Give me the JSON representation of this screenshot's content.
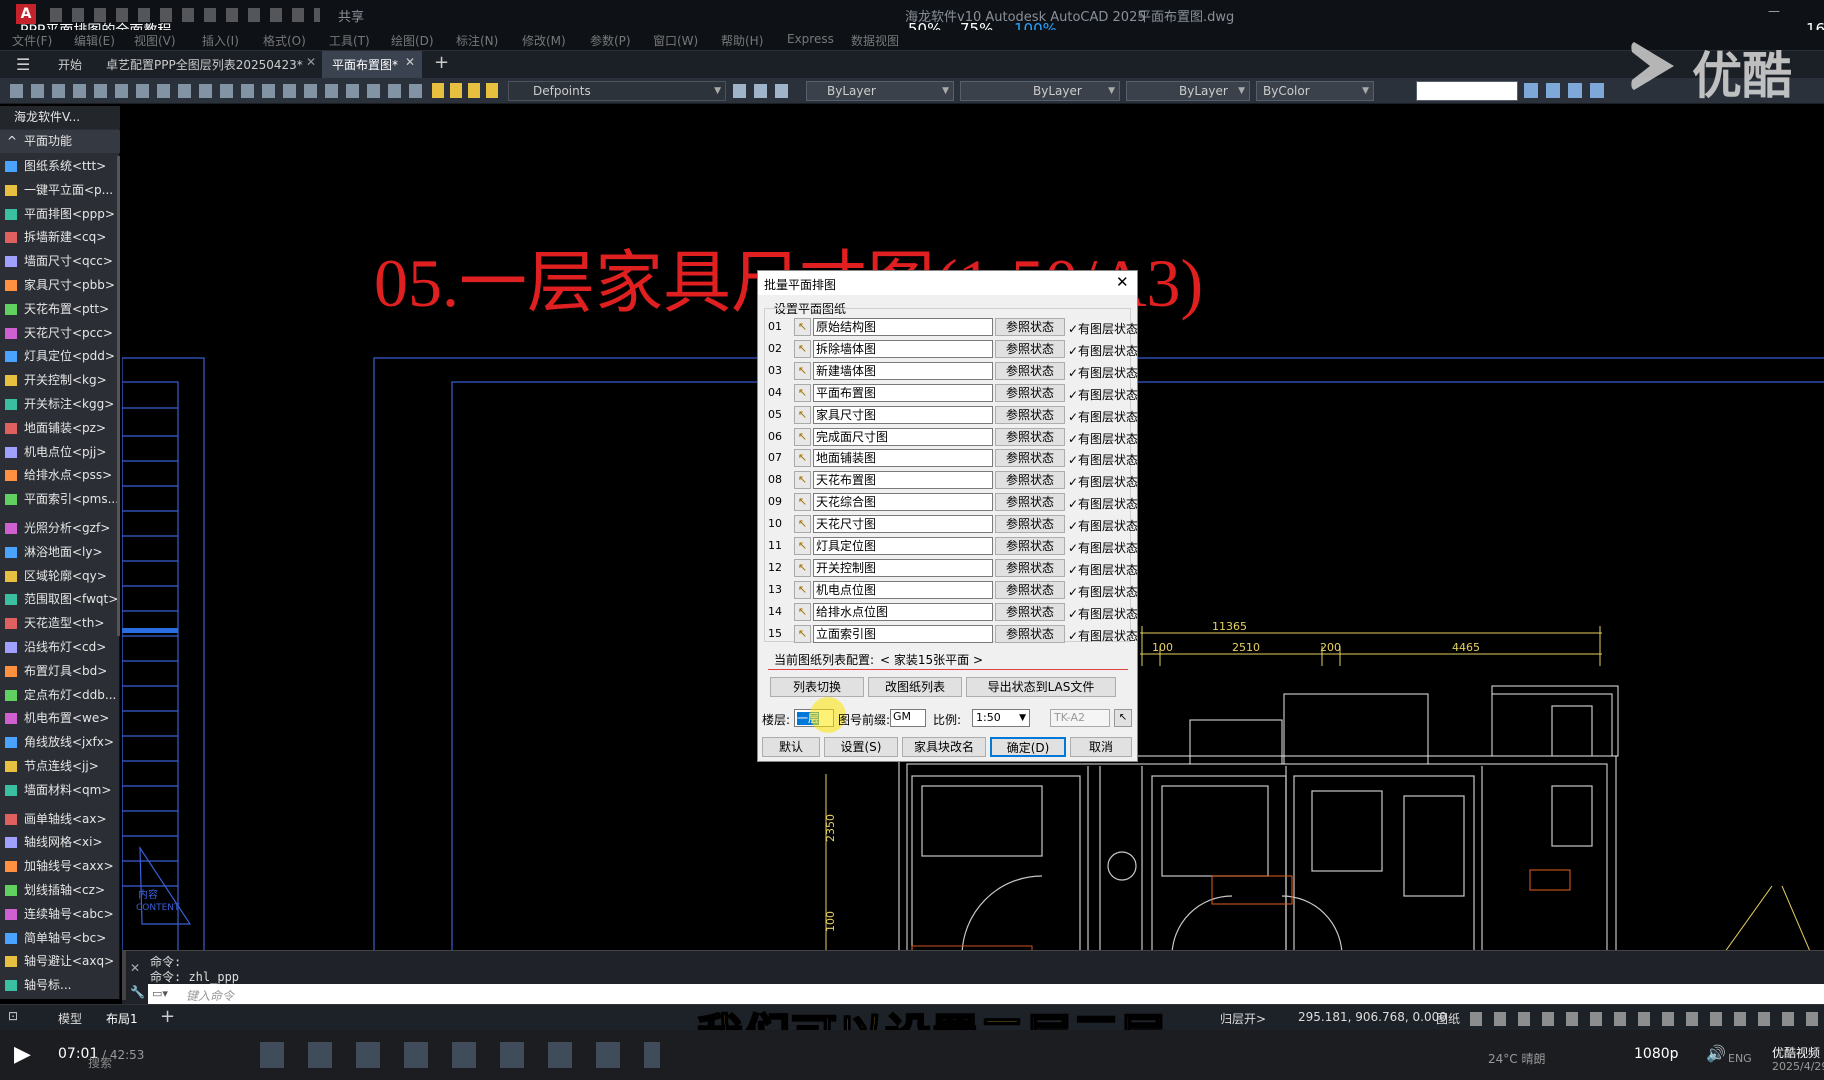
{
  "titlebar": {
    "video_title": "PPP平面排图的全面教程",
    "app_title": "海龙软件v10 Autodesk AutoCAD 2025",
    "file_name": "平面布置图.dwg",
    "share": "共享",
    "speed": [
      "50%",
      "75%",
      "100%"
    ],
    "clock_tail": "16"
  },
  "menu": [
    "文件(F)",
    "编辑(E)",
    "视图(V)",
    "插入(I)",
    "格式(O)",
    "工具(T)",
    "绘图(D)",
    "标注(N)",
    "修改(M)",
    "参数(P)",
    "窗口(W)",
    "帮助(H)",
    "Express",
    "数据视图"
  ],
  "tabs": {
    "start": "开始",
    "tab1": "卓艺配置PPP全图层列表20250423*",
    "tab2": "平面布置图*"
  },
  "toolbar": {
    "layer": "Defpoints",
    "color": "ByLayer",
    "linetype": "ByLayer",
    "lineweight": "ByLayer",
    "plotstyle": "ByColor"
  },
  "watermark": "优酷",
  "palette": {
    "header": "海龙软件V...",
    "section": "平面功能",
    "items": [
      "图纸系统<ttt>",
      "一键平立面<p...",
      "平面排图<ppp>",
      "拆墙新建<cq>",
      "墙面尺寸<qcc>",
      "家具尺寸<pbb>",
      "天花布置<ptt>",
      "天花尺寸<pcc>",
      "灯具定位<pdd>",
      "开关控制<kg>",
      "开关标注<kgg>",
      "地面铺装<pz>",
      "机电点位<pjj>",
      "给排水点<pss>",
      "平面索引<pms...",
      "光照分析<gzf>",
      "淋浴地面<ly>",
      "区域轮廓<qy>",
      "范围取图<fwqt>",
      "天花造型<th>",
      "沿线布灯<cd>",
      "布置灯具<bd>",
      "定点布灯<ddb...",
      "机电布置<we>",
      "角线放线<jxfx>",
      "节点连线<jj>",
      "墙面材料<qm>",
      "画单轴线<ax>",
      "轴线网格<xi>",
      "加轴线号<axx>",
      "划线插轴<cz>",
      "连续轴号<abc>",
      "简单轴号<bc>",
      "轴号避让<axq>",
      "轴号标..."
    ]
  },
  "drawing": {
    "title": "05.一层家具尺寸图(1:50/A3)",
    "dims": {
      "total": "11365",
      "d1": "100",
      "d2": "2510",
      "d3": "200",
      "d4": "4465",
      "v1": "2350",
      "v2": "100"
    },
    "small_text": "内容\nCONTENT"
  },
  "dialog": {
    "title": "批量平面排图",
    "group": "设置平面图纸",
    "ref_label": "参照状态",
    "state_label": "✓有图层状态",
    "rows": [
      {
        "n": "01",
        "name": "原始结构图"
      },
      {
        "n": "02",
        "name": "拆除墙体图"
      },
      {
        "n": "03",
        "name": "新建墙体图"
      },
      {
        "n": "04",
        "name": "平面布置图"
      },
      {
        "n": "05",
        "name": "家具尺寸图"
      },
      {
        "n": "06",
        "name": "完成面尺寸图"
      },
      {
        "n": "07",
        "name": "地面铺装图"
      },
      {
        "n": "08",
        "name": "天花布置图"
      },
      {
        "n": "09",
        "name": "天花综合图"
      },
      {
        "n": "10",
        "name": "天花尺寸图"
      },
      {
        "n": "11",
        "name": "灯具定位图"
      },
      {
        "n": "12",
        "name": "开关控制图"
      },
      {
        "n": "13",
        "name": "机电点位图"
      },
      {
        "n": "14",
        "name": "给排水点位图"
      },
      {
        "n": "15",
        "name": "立面索引图"
      }
    ],
    "config_label": "当前图纸列表配置:",
    "config_value": "< 家装15张平面 >",
    "btn_switch": "列表切换",
    "btn_modify": "改图纸列表",
    "btn_export": "导出状态到LAS文件",
    "floor_label": "楼层:",
    "floor_value": "一层",
    "prefix_label": "图号前缀:",
    "prefix_value": "GM",
    "scale_label": "比例:",
    "scale_value": "1:50",
    "frame_value": "TK-A2",
    "btn_default": "默认",
    "btn_settings": "设置(S)",
    "btn_rename": "家具块改名",
    "btn_ok": "确定(D)",
    "btn_cancel": "取消"
  },
  "command": {
    "line1": "命令:",
    "line2": "命令: zhl_ppp",
    "placeholder": "键入命令"
  },
  "status": {
    "model": "模型",
    "layout": "布局1",
    "coords": "295.181, 906.768, 0.000",
    "paper": "图纸",
    "layer_open": "归层开>"
  },
  "subtitle": "我们可以设置二层三层",
  "player": {
    "time": "07:01",
    "total": "/ 42:53",
    "search": "搜索",
    "weather": "24°C 晴朗",
    "quality": "1080p",
    "lang": "ENG",
    "brand": "优酷视频",
    "date": "2025/4/29"
  }
}
